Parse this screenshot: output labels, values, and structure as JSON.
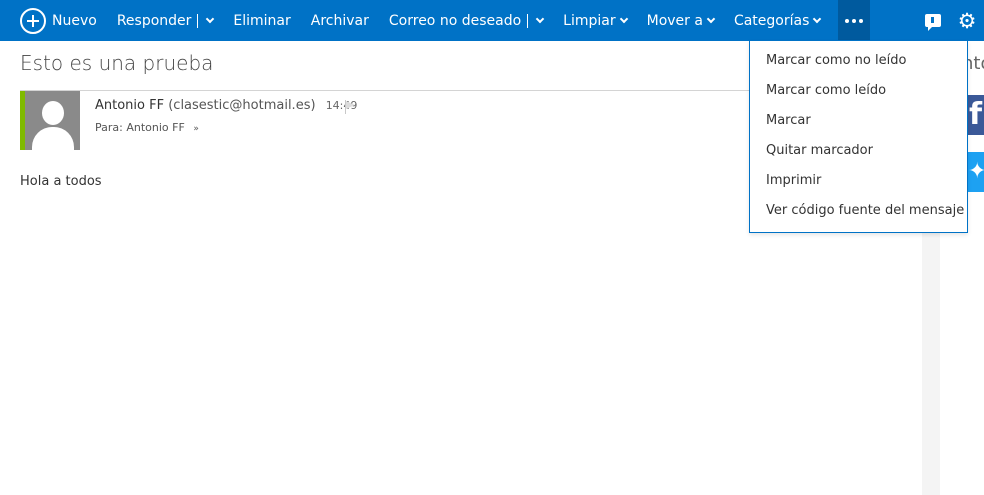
{
  "toolbar": {
    "new_label": "Nuevo",
    "reply_label": "Responder",
    "delete_label": "Eliminar",
    "archive_label": "Archivar",
    "junk_label": "Correo no deseado",
    "sweep_label": "Limpiar",
    "move_label": "Mover a",
    "categories_label": "Categorías",
    "more_icon": "ellipsis-icon",
    "chat_icon": "chat-icon",
    "settings_icon": "gear-icon"
  },
  "message": {
    "subject": "Esto es una prueba",
    "sender_name": "Antonio FF",
    "sender_email": "(clasestic@hotmail.es)",
    "time": "14:49",
    "to_label": "Para:",
    "to_name": "Antonio FF",
    "body": "Hola a todos"
  },
  "more_menu": {
    "items": [
      {
        "label": "Marcar como no leído"
      },
      {
        "label": "Marcar como leído"
      },
      {
        "label": "Marcar"
      },
      {
        "label": "Quitar marcador"
      },
      {
        "label": "Imprimir"
      },
      {
        "label": "Ver código fuente del mensaje"
      }
    ]
  },
  "right_panel": {
    "heading_fragment": "nto"
  },
  "colors": {
    "toolbar": "#0072c6",
    "more_active": "#005a9e",
    "avatar_accent": "#7fba00",
    "facebook": "#3b5998",
    "twitter": "#1da1f2"
  }
}
